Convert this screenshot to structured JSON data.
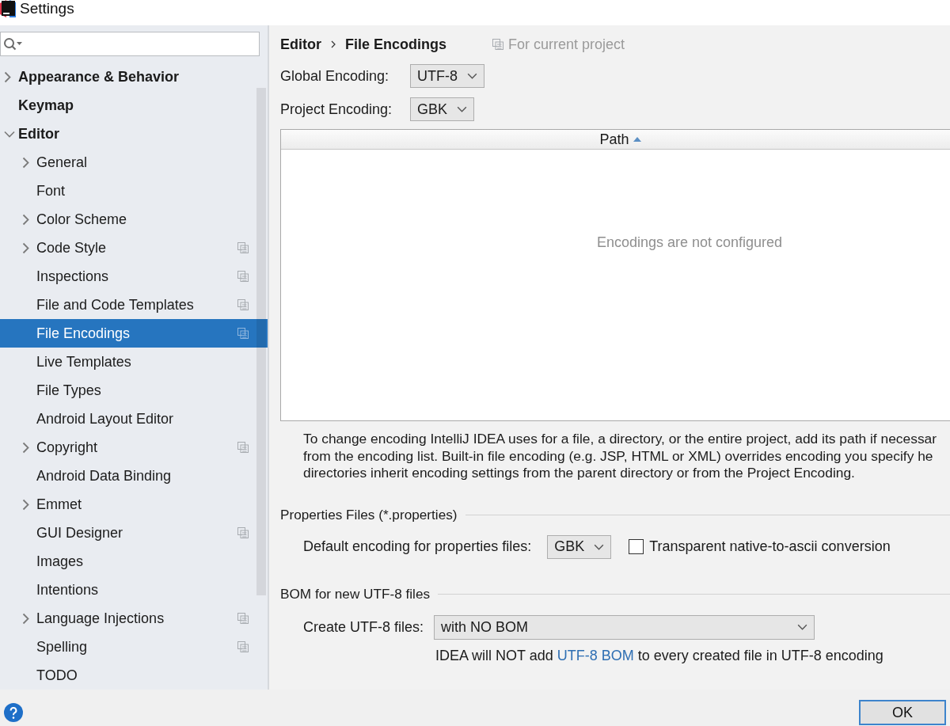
{
  "window": {
    "title": "Settings"
  },
  "sidebar": {
    "items": [
      {
        "label": "Appearance & Behavior",
        "kind": "folder",
        "expanded": false,
        "selected": false,
        "project_level": false
      },
      {
        "label": "Keymap",
        "kind": "leaf",
        "selected": false,
        "project_level": false
      },
      {
        "label": "Editor",
        "kind": "folder",
        "expanded": true,
        "selected": false,
        "project_level": false,
        "children": [
          {
            "label": "General",
            "kind": "folder",
            "expanded": false,
            "selected": false,
            "project_level": false
          },
          {
            "label": "Font",
            "kind": "leaf",
            "selected": false,
            "project_level": false
          },
          {
            "label": "Color Scheme",
            "kind": "folder",
            "expanded": false,
            "selected": false,
            "project_level": false
          },
          {
            "label": "Code Style",
            "kind": "folder",
            "expanded": false,
            "selected": false,
            "project_level": true
          },
          {
            "label": "Inspections",
            "kind": "leaf",
            "selected": false,
            "project_level": true
          },
          {
            "label": "File and Code Templates",
            "kind": "leaf",
            "selected": false,
            "project_level": true
          },
          {
            "label": "File Encodings",
            "kind": "leaf",
            "selected": true,
            "project_level": true
          },
          {
            "label": "Live Templates",
            "kind": "leaf",
            "selected": false,
            "project_level": false
          },
          {
            "label": "File Types",
            "kind": "leaf",
            "selected": false,
            "project_level": false
          },
          {
            "label": "Android Layout Editor",
            "kind": "leaf",
            "selected": false,
            "project_level": false
          },
          {
            "label": "Copyright",
            "kind": "folder",
            "expanded": false,
            "selected": false,
            "project_level": true
          },
          {
            "label": "Android Data Binding",
            "kind": "leaf",
            "selected": false,
            "project_level": false
          },
          {
            "label": "Emmet",
            "kind": "folder",
            "expanded": false,
            "selected": false,
            "project_level": false
          },
          {
            "label": "GUI Designer",
            "kind": "leaf",
            "selected": false,
            "project_level": true
          },
          {
            "label": "Images",
            "kind": "leaf",
            "selected": false,
            "project_level": false
          },
          {
            "label": "Intentions",
            "kind": "leaf",
            "selected": false,
            "project_level": false
          },
          {
            "label": "Language Injections",
            "kind": "folder",
            "expanded": false,
            "selected": false,
            "project_level": true
          },
          {
            "label": "Spelling",
            "kind": "leaf",
            "selected": false,
            "project_level": true
          },
          {
            "label": "TODO",
            "kind": "leaf",
            "selected": false,
            "project_level": false
          }
        ]
      }
    ]
  },
  "breadcrumb": [
    "Editor",
    "File Encodings"
  ],
  "scope_note": "For current project",
  "encoding_settings": [
    {
      "label": "Global Encoding:",
      "value": "UTF-8"
    },
    {
      "label": "Project Encoding:",
      "value": "GBK"
    }
  ],
  "table": {
    "columns": [
      {
        "label": "Path",
        "sorted_ascending": true
      }
    ],
    "empty_text": "Encodings are not configured"
  },
  "description_lines": [
    "To change encoding IntelliJ IDEA uses for a file, a directory, or the entire project, add its path if necessar",
    "from the encoding list. Built-in file encoding (e.g. JSP, HTML or XML) overrides encoding you specify he",
    "directories inherit encoding settings from the parent directory or from the Project Encoding."
  ],
  "properties_files": {
    "title": "Properties Files (*.properties)",
    "default_encoding": {
      "label": "Default encoding for properties files:",
      "value": "GBK"
    },
    "native_to_ascii": {
      "label": "Transparent native-to-ascii conversion",
      "checked": false
    }
  },
  "bom": {
    "title": "BOM for new UTF-8 files",
    "create": {
      "label": "Create UTF-8 files:",
      "value": "with NO BOM"
    },
    "note": [
      {
        "kind": "text",
        "text": "IDEA will NOT add "
      },
      {
        "kind": "link",
        "text": "UTF-8 BOM"
      },
      {
        "kind": "text",
        "text": " to every created file in UTF-8 encoding"
      }
    ]
  },
  "buttons": [
    {
      "label": "OK",
      "default": true
    }
  ]
}
